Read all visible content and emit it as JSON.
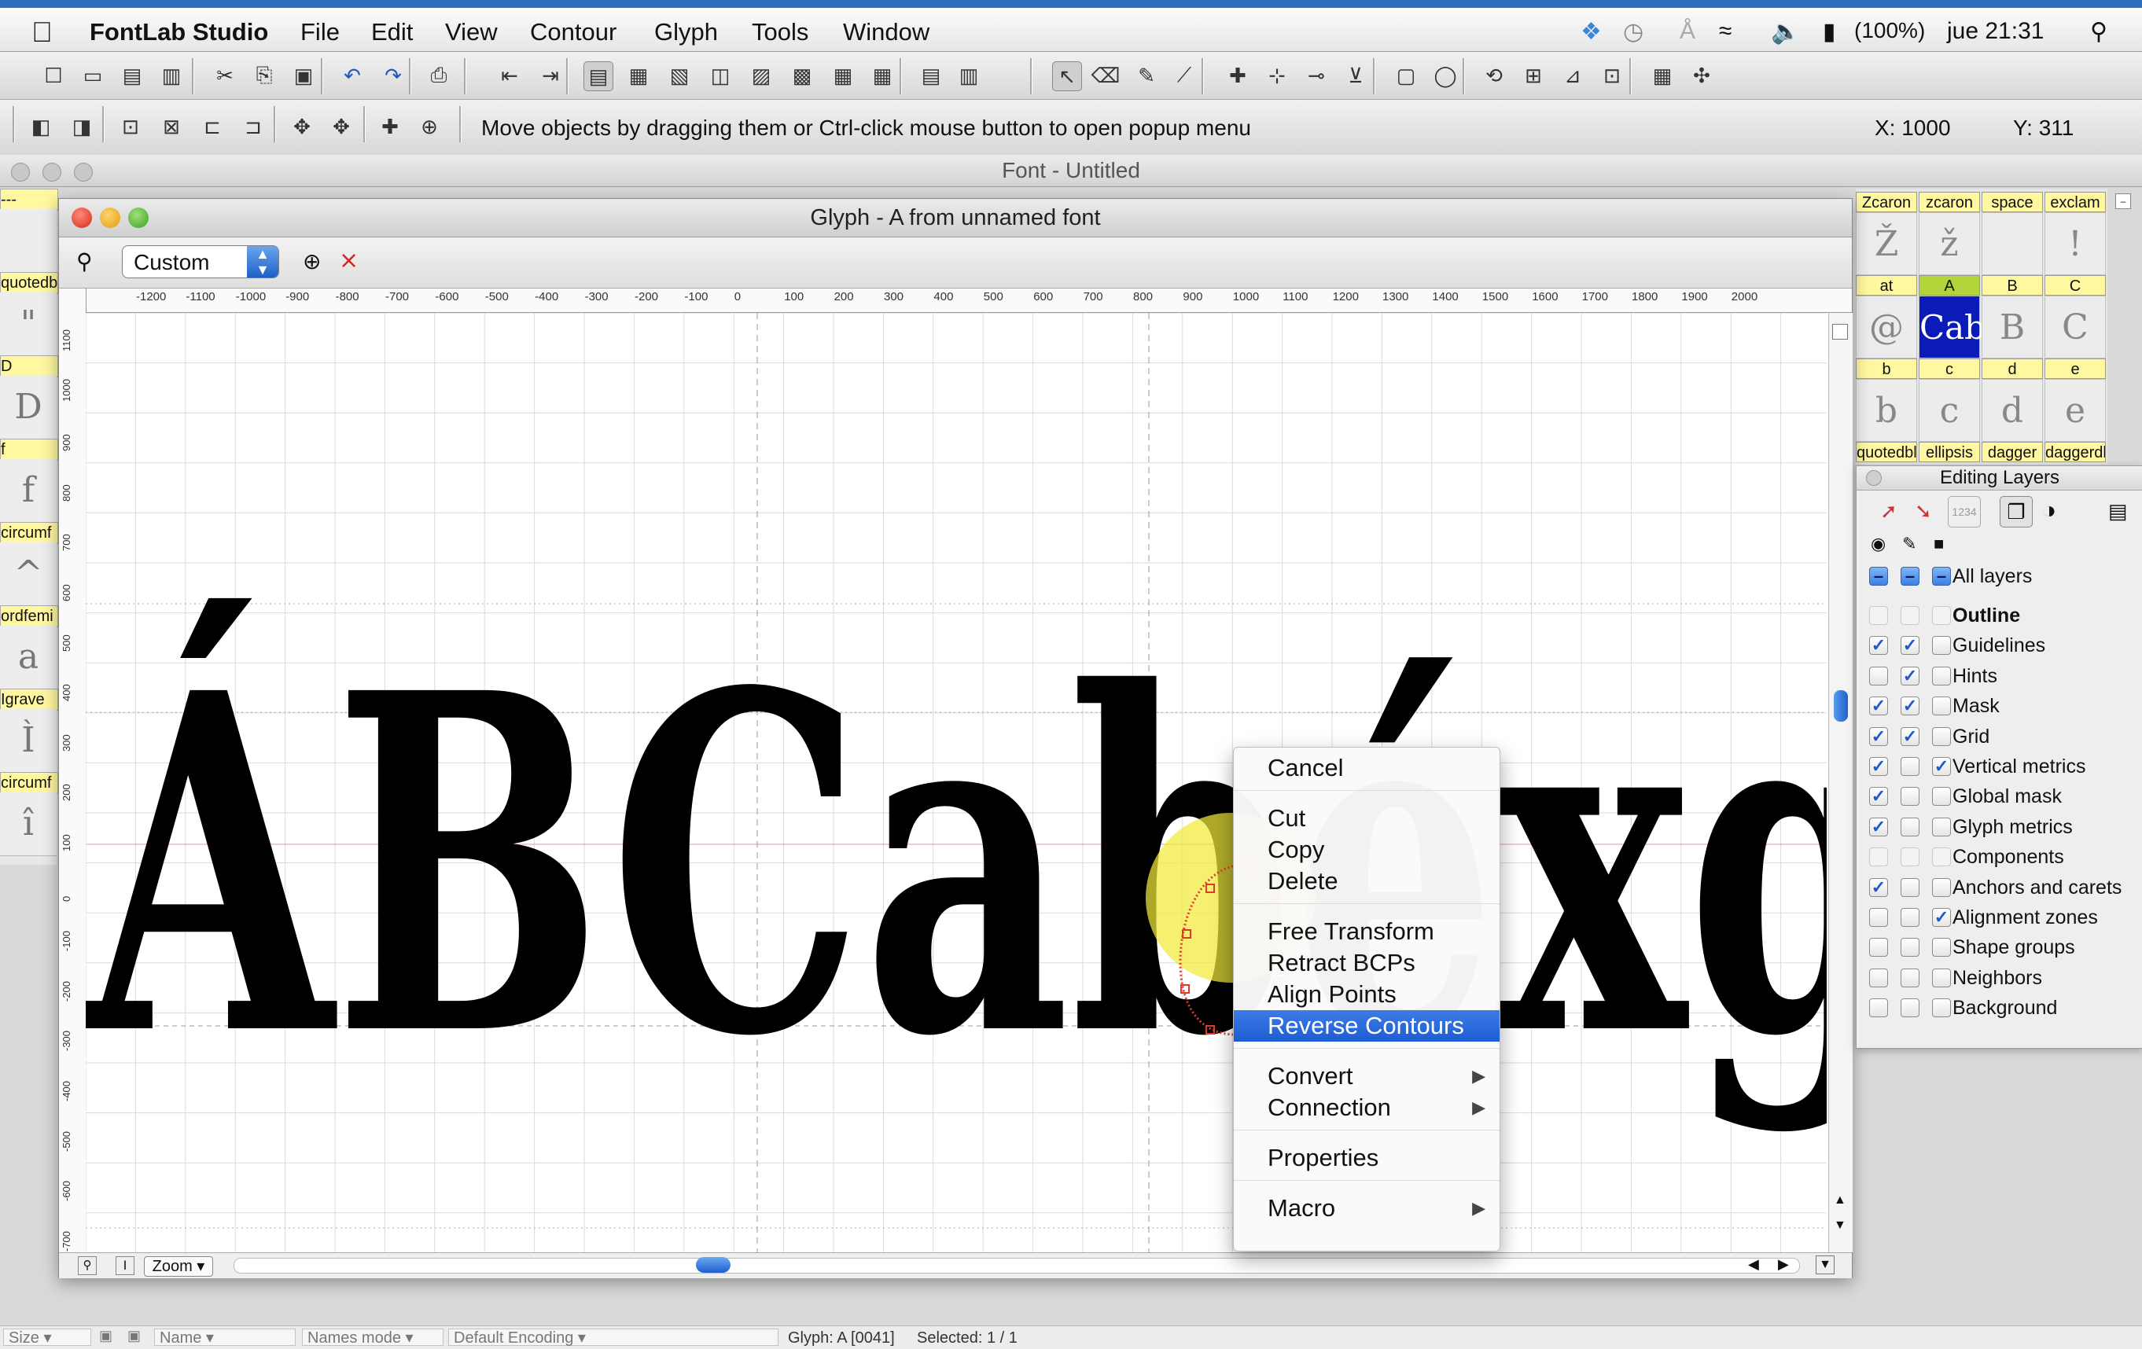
{
  "menubar": {
    "app_name": "FontLab Studio",
    "menus": [
      "File",
      "Edit",
      "View",
      "Contour",
      "Glyph",
      "Tools",
      "Window"
    ],
    "battery": "(100%)",
    "clock": "jue 21:31"
  },
  "toolbar2": {
    "hint": "Move objects by dragging them or Ctrl-click mouse button to open popup menu",
    "coord_x": "X: 1000",
    "coord_y": "Y: 311"
  },
  "font_window": {
    "title": "Font - Untitled"
  },
  "left_strip": [
    {
      "label": "---",
      "glyph": ""
    },
    {
      "label": "quotedbl",
      "glyph": "\""
    },
    {
      "label": "D",
      "glyph": "D"
    },
    {
      "label": "f",
      "glyph": "f"
    },
    {
      "label": "circumf",
      "glyph": "^"
    },
    {
      "label": "ordfemi",
      "glyph": "a"
    },
    {
      "label": "Igrave",
      "glyph": "Ì"
    },
    {
      "label": "circumf",
      "glyph": "î"
    }
  ],
  "right_grid": {
    "rows": [
      {
        "labels": [
          "Zcaron",
          "zcaron",
          "space",
          "exclam"
        ],
        "glyphs": [
          "Ž",
          "ž",
          "",
          "!"
        ]
      },
      {
        "labels": [
          "at",
          "A",
          "B",
          "C"
        ],
        "glyphs": [
          "@",
          "Cab",
          "B",
          "C"
        ]
      },
      {
        "labels": [
          "b",
          "c",
          "d",
          "e"
        ],
        "glyphs": [
          "b",
          "c",
          "d",
          "e"
        ]
      },
      {
        "labels": [
          "quotedbl",
          "ellipsis",
          "dagger",
          "daggerdl"
        ],
        "glyphs": []
      }
    ]
  },
  "glyph_window": {
    "title": "Glyph - A from unnamed font",
    "zoom_mode": "Custom",
    "sample_text": "ÁBCabéxg",
    "hruler_ticks": [
      "-1200",
      "-1100",
      "-1000",
      "-900",
      "-800",
      "-700",
      "-600",
      "-500",
      "-400",
      "-300",
      "-200",
      "-100",
      "0",
      "100",
      "200",
      "300",
      "400",
      "500",
      "600",
      "700",
      "800",
      "900",
      "1000",
      "1100",
      "1200",
      "1300",
      "1400",
      "1500",
      "1600",
      "1700",
      "1800",
      "1900",
      "2000"
    ],
    "vruler_ticks": [
      "1100",
      "1000",
      "900",
      "800",
      "700",
      "600",
      "500",
      "400",
      "300",
      "200",
      "100",
      "0",
      "-100",
      "-200",
      "-300",
      "-400",
      "-500",
      "-600",
      "-700"
    ],
    "zoom_button": "Zoom"
  },
  "context_menu": {
    "items": [
      {
        "label": "Cancel",
        "submenu": false,
        "highlighted": false
      },
      {
        "label": "Cut",
        "submenu": false,
        "highlighted": false
      },
      {
        "label": "Copy",
        "submenu": false,
        "highlighted": false
      },
      {
        "label": "Delete",
        "submenu": false,
        "highlighted": false
      },
      {
        "label": "Free Transform",
        "submenu": false,
        "highlighted": false
      },
      {
        "label": "Retract BCPs",
        "submenu": false,
        "highlighted": false
      },
      {
        "label": "Align Points",
        "submenu": false,
        "highlighted": false
      },
      {
        "label": "Reverse Contours",
        "submenu": false,
        "highlighted": true
      },
      {
        "label": "Convert",
        "submenu": true,
        "highlighted": false
      },
      {
        "label": "Connection",
        "submenu": true,
        "highlighted": false
      },
      {
        "label": "Properties",
        "submenu": false,
        "highlighted": false
      },
      {
        "label": "Macro",
        "submenu": true,
        "highlighted": false
      }
    ]
  },
  "editing_layers": {
    "title": "Editing Layers",
    "all_layers_label": "All layers",
    "layers": [
      {
        "name": "Outline",
        "a": false,
        "b": false,
        "c": false
      },
      {
        "name": "Guidelines",
        "a": true,
        "b": true,
        "c": false
      },
      {
        "name": "Hints",
        "a": false,
        "b": true,
        "c": false
      },
      {
        "name": "Mask",
        "a": true,
        "b": true,
        "c": false
      },
      {
        "name": "Grid",
        "a": true,
        "b": true,
        "c": false
      },
      {
        "name": "Vertical metrics",
        "a": true,
        "b": false,
        "c": true
      },
      {
        "name": "Global mask",
        "a": true,
        "b": false,
        "c": false
      },
      {
        "name": "Glyph metrics",
        "a": true,
        "b": false,
        "c": false
      },
      {
        "name": "Components",
        "a": false,
        "b": false,
        "c": false
      },
      {
        "name": "Anchors and carets",
        "a": true,
        "b": false,
        "c": false
      },
      {
        "name": "Alignment zones",
        "a": false,
        "b": false,
        "c": true
      },
      {
        "name": "Shape groups",
        "a": false,
        "b": false,
        "c": false
      },
      {
        "name": "Neighbors",
        "a": false,
        "b": false,
        "c": false
      },
      {
        "name": "Background",
        "a": false,
        "b": false,
        "c": false
      }
    ]
  },
  "statusbar": {
    "size": "Size",
    "name": "Name",
    "names_mode": "Names mode",
    "encoding": "Default Encoding",
    "glyph_info": "Glyph: A [0041]",
    "selected": "Selected: 1 / 1"
  },
  "colors": {
    "menubar_accent": "#2e6fbd",
    "highlight": "#1d5dd3",
    "cursor_halo": "#f2ea3a",
    "selected_cell": "#0a1bb8",
    "contour_selection": "#e03a2a"
  },
  "icons": {
    "toolbar1": [
      "new-icon",
      "open-icon",
      "save-icon",
      "save-all-icon",
      "cut-icon",
      "copy-icon",
      "paste-icon",
      "undo-icon",
      "redo-icon",
      "print-icon",
      "metrics-icon",
      "kerning-icon",
      "font-info-icon",
      "table-icon",
      "layers-icon",
      "opentype-icon",
      "classes-icon",
      "panel-icon",
      "list-icon",
      "grid-icon",
      "preview-icon",
      "report-icon",
      "pointer-icon",
      "eraser-icon",
      "pen-icon",
      "knife-icon",
      "add-point-icon",
      "add-node-icon",
      "smooth-node-icon",
      "corner-node-icon",
      "rectangle-icon",
      "ellipse-icon",
      "rotate-icon",
      "scale-icon",
      "slant-icon",
      "transform-icon",
      "palette-icon",
      "hinting-icon"
    ],
    "toolbar2": [
      "open-path-icon",
      "close-path-icon",
      "select-icon",
      "crop-icon",
      "metrics-tool-icon",
      "curve-tool-icon",
      "move-icon",
      "rotate-tool-icon",
      "align-icon",
      "center-icon"
    ]
  }
}
